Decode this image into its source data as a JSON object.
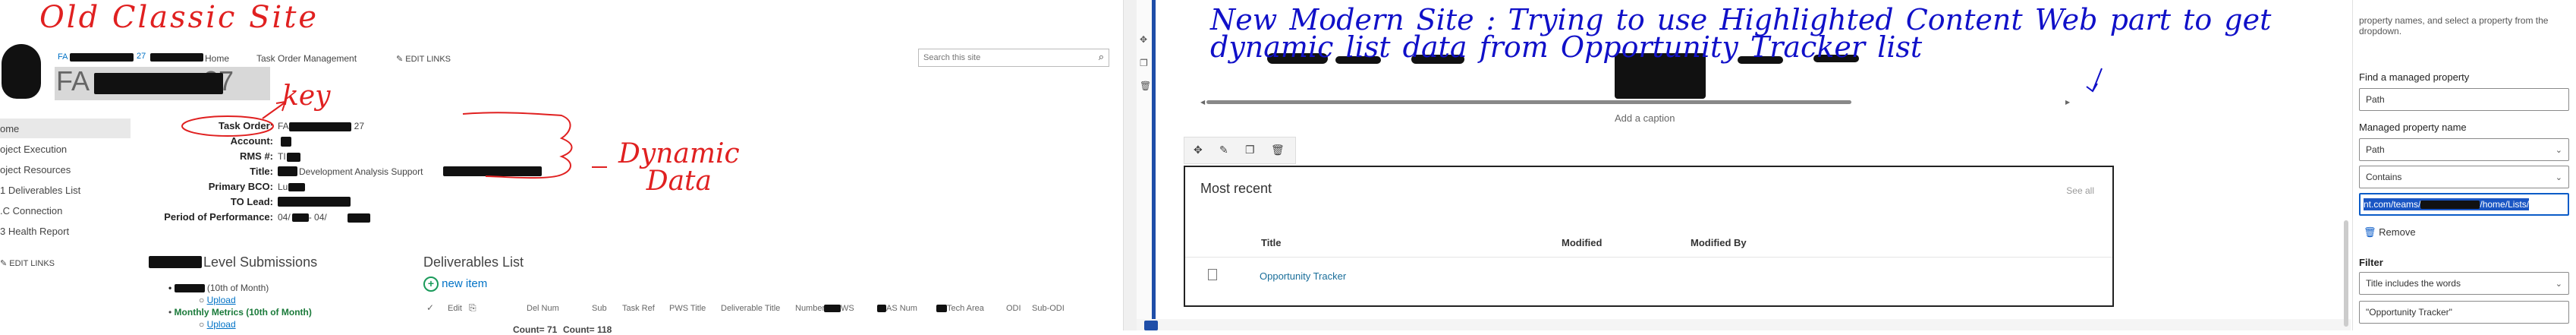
{
  "annotations": {
    "old_site": "Old Classic Site",
    "key": "key",
    "dynamic_data": "Dynamic\nData",
    "dash": "-",
    "new_site": "New Modern Site : Trying to use Highlighted Content Web part to get dynamic list data from Opportunity Tracker list"
  },
  "classic": {
    "site_title": "FA",
    "site_title_suffix": "27",
    "breadcrumb": [
      "FA",
      "27",
      "Home",
      "Task Order Management"
    ],
    "edit_links": "EDIT LINKS",
    "search_placeholder": "Search this site",
    "nav": [
      "ome",
      "oject Execution",
      "oject Resources",
      "1 Deliverables List",
      ".C Connection",
      "3 Health Report"
    ],
    "nav_edit_links": "EDIT LINKS",
    "fields": {
      "task_order_label": "Task Order:",
      "task_order_value_a": "FA",
      "task_order_value_b": "27",
      "account_label": "Account:",
      "rms_label": "RMS #:",
      "rms_value": "TI",
      "title_label": "Title:",
      "title_value": "Development Analysis Support",
      "primary_bco_label": "Primary BCO:",
      "primary_bco_value": "Lu",
      "to_lead_label": "TO Lead:",
      "pop_label": "Period of Performance:",
      "pop_value_a": "04/",
      "pop_value_b": "- 04/"
    },
    "level_submissions_title": "Level Submissions",
    "submissions": [
      {
        "text": "(10th of Month)",
        "bold": false
      },
      {
        "text": "Upload",
        "link": true
      },
      {
        "text": "Monthly Metrics (10th of Month)",
        "bold": true
      },
      {
        "text": "Upload",
        "link": true
      }
    ],
    "deliverables_title": "Deliverables List",
    "new_item": "new item",
    "columns": [
      "Edit",
      "Del Num",
      "Sub",
      "Task Ref",
      "PWS Title",
      "Deliverable Title",
      "Number",
      "WS",
      "AS Num",
      "Tech Area",
      "ODI",
      "Sub-ODI"
    ],
    "count_text": "Count= 71",
    "count_text2": "Count= 118"
  },
  "modern": {
    "caption": "Add a caption",
    "highlighted": {
      "title": "Most recent",
      "see_all": "See all",
      "columns": [
        "Title",
        "Modified",
        "Modified By"
      ],
      "rows": [
        {
          "title": "Opportunity Tracker"
        }
      ]
    }
  },
  "pane": {
    "intro": "property names, and select a property from the dropdown.",
    "intro2": "the dropdown.",
    "find_label": "Find a managed property",
    "find_value": "Path",
    "mpn_label": "Managed property name",
    "mpn_value": "Path",
    "operator": "Contains",
    "url_value_a": "nt.com/teams/",
    "url_value_b": "/home/Lists/",
    "remove": "Remove",
    "filter_label": "Filter",
    "filter_value": "Title includes the words",
    "filter_text": "\"Opportunity Tracker\""
  },
  "colors": {
    "annotation_red": "#e02020",
    "annotation_blue": "#1010c8",
    "sp_link": "#0072c6",
    "modern_accent": "#1f4ea8",
    "highlight_select": "#1a56c4"
  }
}
